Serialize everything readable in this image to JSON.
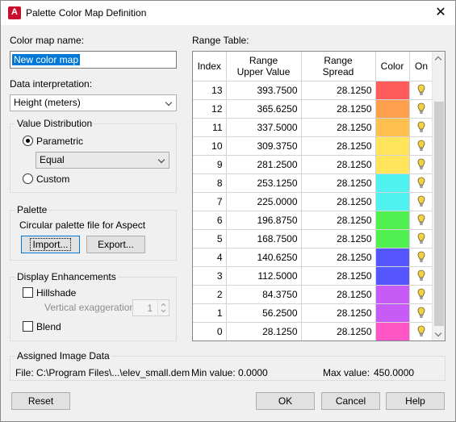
{
  "window": {
    "title": "Palette Color Map Definition",
    "app_icon": "A",
    "close_glyph": "✕"
  },
  "left": {
    "color_map_name_label": "Color map name:",
    "color_map_name_value": "New color map",
    "data_interpretation_label": "Data interpretation:",
    "data_interpretation_value": "Height (meters)",
    "value_distribution": {
      "title": "Value Distribution",
      "parametric_label": "Parametric",
      "parametric_selected": true,
      "method_value": "Equal",
      "custom_label": "Custom"
    },
    "palette": {
      "title": "Palette",
      "description": "Circular palette file for Aspect",
      "import_label": "Import...",
      "export_label": "Export..."
    },
    "display_enhancements": {
      "title": "Display Enhancements",
      "hillshade_label": "Hillshade",
      "vertical_exaggeration_label": "Vertical exaggeration",
      "vertical_exaggeration_value": "1",
      "blend_label": "Blend"
    }
  },
  "range_table": {
    "label": "Range Table:",
    "headers": {
      "index": "Index",
      "upper_line1": "Range",
      "upper_line2": "Upper Value",
      "spread_line1": "Range",
      "spread_line2": "Spread",
      "color": "Color",
      "on": "On"
    },
    "rows": [
      {
        "index": "13",
        "upper": "393.7500",
        "spread": "28.1250",
        "color": "#ff5c5c"
      },
      {
        "index": "12",
        "upper": "365.6250",
        "spread": "28.1250",
        "color": "#ffa04f"
      },
      {
        "index": "11",
        "upper": "337.5000",
        "spread": "28.1250",
        "color": "#ffc04f"
      },
      {
        "index": "10",
        "upper": "309.3750",
        "spread": "28.1250",
        "color": "#ffe45c"
      },
      {
        "index": "9",
        "upper": "281.2500",
        "spread": "28.1250",
        "color": "#ffe45c"
      },
      {
        "index": "8",
        "upper": "253.1250",
        "spread": "28.1250",
        "color": "#4ff2ee"
      },
      {
        "index": "7",
        "upper": "225.0000",
        "spread": "28.1250",
        "color": "#4ff2ee"
      },
      {
        "index": "6",
        "upper": "196.8750",
        "spread": "28.1250",
        "color": "#4ff04f"
      },
      {
        "index": "5",
        "upper": "168.7500",
        "spread": "28.1250",
        "color": "#4ff04f"
      },
      {
        "index": "4",
        "upper": "140.6250",
        "spread": "28.1250",
        "color": "#5656ff"
      },
      {
        "index": "3",
        "upper": "112.5000",
        "spread": "28.1250",
        "color": "#5656ff"
      },
      {
        "index": "2",
        "upper": "84.3750",
        "spread": "28.1250",
        "color": "#c65cf5"
      },
      {
        "index": "1",
        "upper": "56.2500",
        "spread": "28.1250",
        "color": "#c65cf5"
      },
      {
        "index": "0",
        "upper": "28.1250",
        "spread": "28.1250",
        "color": "#ff56c6"
      }
    ]
  },
  "assigned_image": {
    "title": "Assigned Image Data",
    "file_text": "File: C:\\Program Files\\...\\elev_small.dem",
    "min_text": "Min value: 0.0000",
    "max_label": "Max value:",
    "max_value": "450.0000"
  },
  "buttons": {
    "reset": "Reset",
    "ok": "OK",
    "cancel": "Cancel",
    "help": "Help"
  },
  "colors": {
    "accent": "#0078d7",
    "bulb": "#f2d14a"
  }
}
